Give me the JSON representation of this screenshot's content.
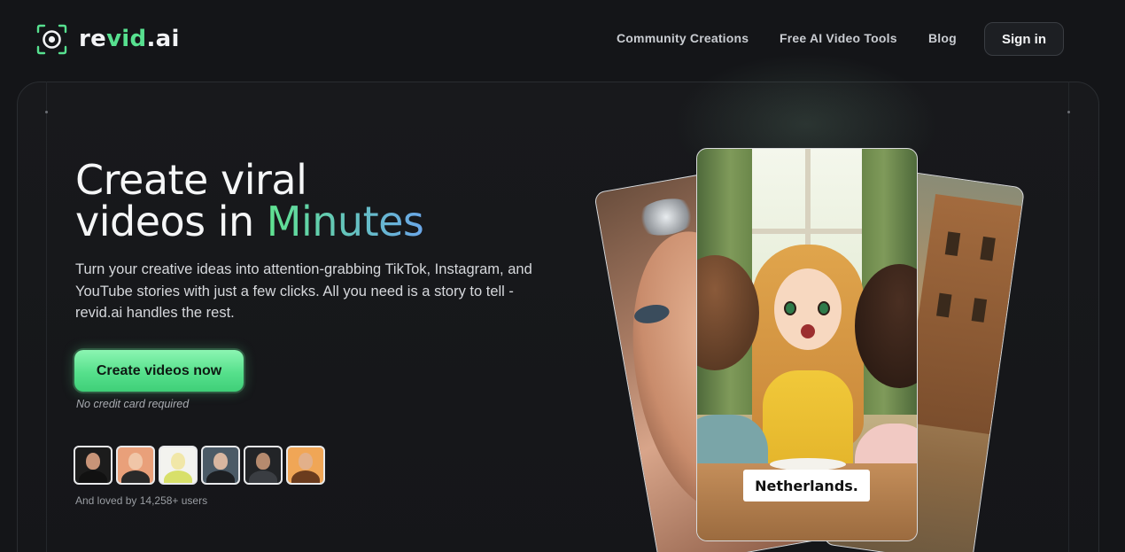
{
  "header": {
    "logo": {
      "text_main": "re",
      "text_accent": "vid",
      "text_tail": ".ai"
    },
    "nav": [
      {
        "label": "Community Creations"
      },
      {
        "label": "Free AI Video Tools"
      },
      {
        "label": "Blog"
      }
    ],
    "signin_label": "Sign in"
  },
  "hero": {
    "headline_line1": "Create viral",
    "headline_line2_prefix": "videos in ",
    "headline_highlight": "Minutes",
    "subtitle": "Turn your creative ideas into attention-grabbing TikTok, Instagram, and YouTube stories with just a few clicks. All you need is a story to tell - revid.ai handles the rest.",
    "cta_label": "Create videos now",
    "cta_note": "No credit card required",
    "social_proof": "And loved by 14,258+ users",
    "avatars": [
      {
        "name": "user-avatar-1",
        "bg": "#1c1c1c",
        "skin": "#c89478",
        "shirt": "#111111"
      },
      {
        "name": "user-avatar-2",
        "bg": "#e9a07a",
        "skin": "#f0c6a8",
        "shirt": "#2a2a2a"
      },
      {
        "name": "user-avatar-3",
        "bg": "#f3f3ef",
        "skin": "#f1e7a8",
        "shirt": "#d8e06a"
      },
      {
        "name": "user-avatar-4",
        "bg": "#4b5a66",
        "skin": "#d8b6a0",
        "shirt": "#1d1f22"
      },
      {
        "name": "user-avatar-5",
        "bg": "#222427",
        "skin": "#b58a6e",
        "shirt": "#3a3d42"
      },
      {
        "name": "user-avatar-6",
        "bg": "#f0a656",
        "skin": "#e2b08a",
        "shirt": "#6b3c1e"
      }
    ]
  },
  "cards": {
    "main_caption": "Netherlands."
  },
  "colors": {
    "background": "#141518",
    "accent_green": "#57e08f",
    "gradient_blue": "#6aa6e8",
    "cta_green": "#56e08c"
  }
}
